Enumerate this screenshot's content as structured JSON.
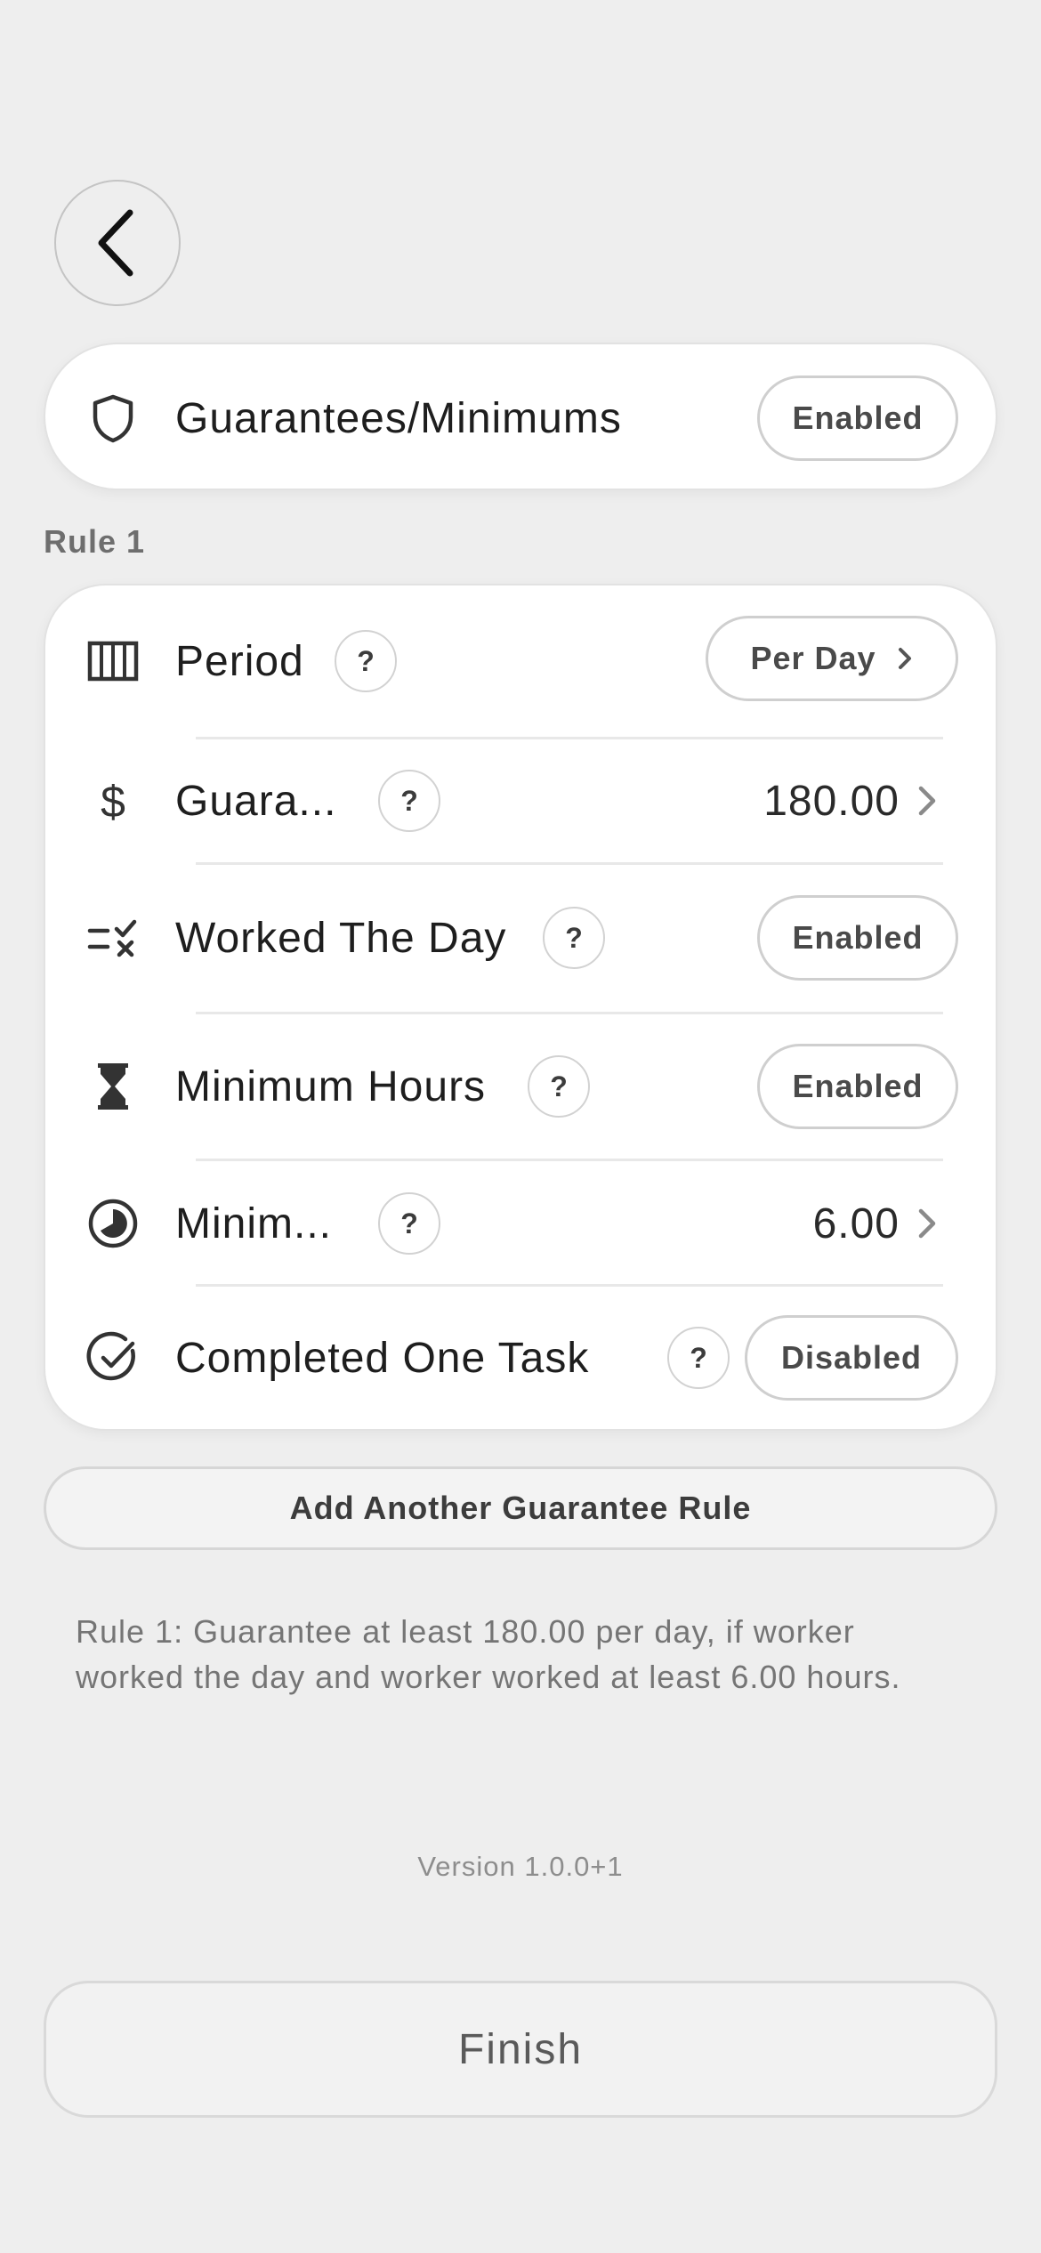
{
  "header": {
    "back_icon": "chevron-left-icon",
    "title": "Guarantees/Minimums",
    "title_icon": "shield-icon",
    "status": "Enabled"
  },
  "rule_section_label": "Rule 1",
  "rules": {
    "period": {
      "icon": "columns-icon",
      "label": "Period",
      "help": "?",
      "value": "Per Day"
    },
    "guarantee": {
      "icon": "dollar-icon",
      "label": "Guara...",
      "help": "?",
      "value": "180.00"
    },
    "worked_the_day": {
      "icon": "list-check-x-icon",
      "label": "Worked The Day",
      "help": "?",
      "status": "Enabled"
    },
    "minimum_hours": {
      "icon": "hourglass-icon",
      "label": "Minimum Hours",
      "help": "?",
      "status": "Enabled"
    },
    "minimum_value": {
      "icon": "pie-clock-icon",
      "label": "Minim...",
      "help": "?",
      "value": "6.00"
    },
    "completed_one_task": {
      "icon": "check-circle-icon",
      "label": "Completed One Task",
      "help": "?",
      "status": "Disabled"
    }
  },
  "add_rule_label": "Add Another Guarantee Rule",
  "summary": "Rule 1: Guarantee at least 180.00 per day, if worker worked the day and worker worked at least 6.00 hours.",
  "version": "Version 1.0.0+1",
  "finish_label": "Finish",
  "colors": {
    "background": "#eeeeee",
    "card": "#ffffff",
    "text": "#1e1e1e",
    "muted": "#757575"
  }
}
